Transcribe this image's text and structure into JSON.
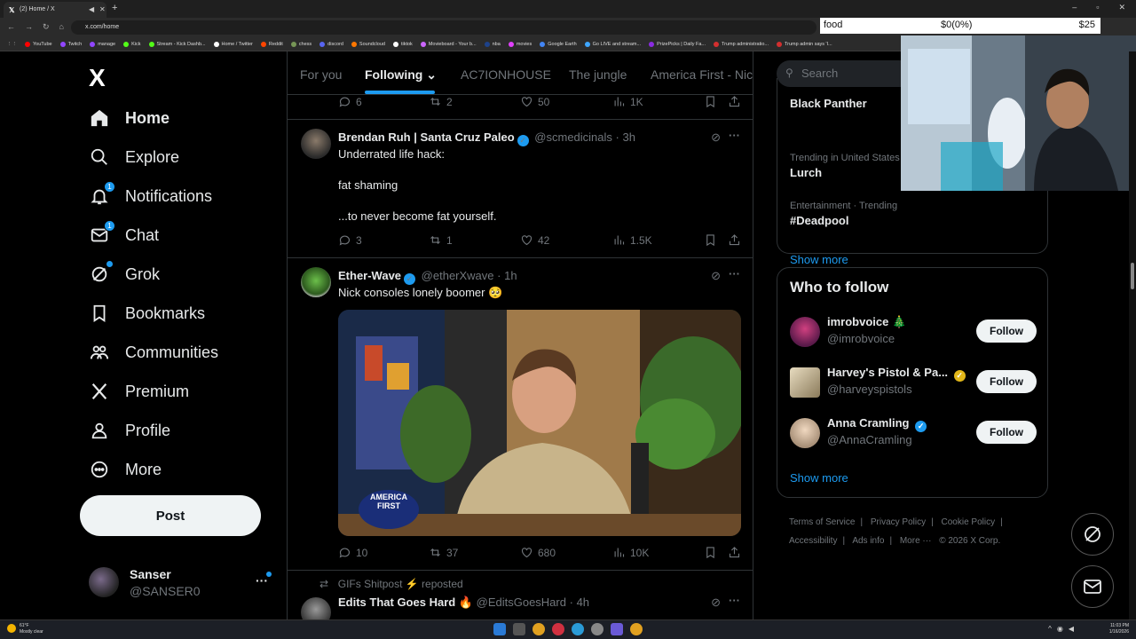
{
  "browser": {
    "tab_title": "(2) Home / X",
    "url": "x.com/home",
    "bookmarks": [
      {
        "label": "YouTube",
        "color": "#ff0000"
      },
      {
        "label": "Twitch",
        "color": "#9146ff"
      },
      {
        "label": "manage",
        "color": "#9146ff"
      },
      {
        "label": "Kick",
        "color": "#53fc18"
      },
      {
        "label": "Stream - Kick Dashb...",
        "color": "#53fc18"
      },
      {
        "label": "Home / Twitter",
        "color": "#ffffff"
      },
      {
        "label": "Reddit",
        "color": "#ff4500"
      },
      {
        "label": "chess",
        "color": "#769656"
      },
      {
        "label": "discord",
        "color": "#5865f2"
      },
      {
        "label": "Soundcloud",
        "color": "#ff7700"
      },
      {
        "label": "tiktok",
        "color": "#ffffff"
      },
      {
        "label": "Movieboard - Your b...",
        "color": "#cc66ff"
      },
      {
        "label": "nba",
        "color": "#1d428a"
      },
      {
        "label": "movies",
        "color": "#e040fb"
      },
      {
        "label": "Google Earth",
        "color": "#4285f4"
      },
      {
        "label": "Go LIVE and stream...",
        "color": "#3ea6ff"
      },
      {
        "label": "PrizePicks | Daily Fa...",
        "color": "#8a2be2"
      },
      {
        "label": "Trump administratio...",
        "color": "#d32f2f"
      },
      {
        "label": "Trump admin says 'I...",
        "color": "#d32f2f"
      }
    ]
  },
  "stream_widget": {
    "label": "food",
    "amount": "$0(0%)",
    "goal": "$25"
  },
  "nav": {
    "logo": "X",
    "items": [
      {
        "label": "Home",
        "icon": "home-icon",
        "badge": ""
      },
      {
        "label": "Explore",
        "icon": "search-icon",
        "badge": ""
      },
      {
        "label": "Notifications",
        "icon": "bell-icon",
        "badge": "1"
      },
      {
        "label": "Chat",
        "icon": "mail-icon",
        "badge": "1"
      },
      {
        "label": "Grok",
        "icon": "grok-icon",
        "badge": ""
      },
      {
        "label": "Bookmarks",
        "icon": "bookmark-icon",
        "badge": ""
      },
      {
        "label": "Communities",
        "icon": "communities-icon",
        "badge": ""
      },
      {
        "label": "Premium",
        "icon": "x-logo-icon",
        "badge": ""
      },
      {
        "label": "Profile",
        "icon": "profile-icon",
        "badge": ""
      },
      {
        "label": "More",
        "icon": "more-circle-icon",
        "badge": ""
      }
    ],
    "post_label": "Post",
    "account": {
      "name": "Sanser",
      "handle": "@SANSER0",
      "more": "···"
    }
  },
  "timeline": {
    "tabs": [
      "For you",
      "Following",
      "AC7IONHOUSE",
      "The jungle",
      "America First - Nic"
    ],
    "top_actions": {
      "replies": "6",
      "reposts": "2",
      "likes": "50",
      "views": "1K"
    },
    "tweets": [
      {
        "name": "Brendan Ruh | Santa Cruz Paleo",
        "handle": "@scmedicinals",
        "time": "3h",
        "lines": [
          "Underrated life hack:",
          "fat shaming",
          "...to never become fat yourself."
        ],
        "replies": "3",
        "reposts": "1",
        "likes": "42",
        "views": "1.5K"
      },
      {
        "name": "Ether-Wave",
        "handle": "@etherXwave",
        "time": "1h",
        "text": "Nick consoles lonely boomer 🥺",
        "hat_text": "AMERICA FIRST",
        "replies": "10",
        "reposts": "37",
        "likes": "680",
        "views": "10K"
      },
      {
        "repost_by": "GIFs Shitpost ⚡ reposted",
        "name": "Edits That Goes Hard 🔥",
        "handle": "@EditsGoesHard",
        "time": "4h"
      }
    ]
  },
  "sidebar": {
    "search_placeholder": "Search",
    "trends": [
      {
        "meta": "",
        "name": "Black Panther"
      },
      {
        "meta": "Trending in United States",
        "name": "Lurch"
      },
      {
        "meta": "Entertainment · Trending",
        "name": "#Deadpool"
      }
    ],
    "show_more": "Show more",
    "who_to_follow_title": "Who to follow",
    "follow_suggestions": [
      {
        "name": "imrobvoice 🎄",
        "handle": "@imrobvoice",
        "button": "Follow",
        "verified": ""
      },
      {
        "name": "Harvey's Pistol & Pa...",
        "handle": "@harveyspistols",
        "button": "Follow",
        "verified": "gold"
      },
      {
        "name": "Anna Cramling",
        "handle": "@AnnaCramling",
        "button": "Follow",
        "verified": "blue"
      }
    ],
    "footer_links": [
      "Terms of Service",
      "|",
      "Privacy Policy",
      "|",
      "Cookie Policy",
      "|",
      "Accessibility",
      "|",
      "Ads info",
      "|",
      "More ···",
      "© 2026 X Corp."
    ]
  },
  "taskbar": {
    "weather_temp": "61°F",
    "weather_desc": "Mostly clear",
    "time": "11:03 PM",
    "date": "1/16/2026"
  },
  "colors": {
    "accent": "#1d9bf0",
    "background": "#000000",
    "border": "#2f3336",
    "muted": "#71767b"
  }
}
